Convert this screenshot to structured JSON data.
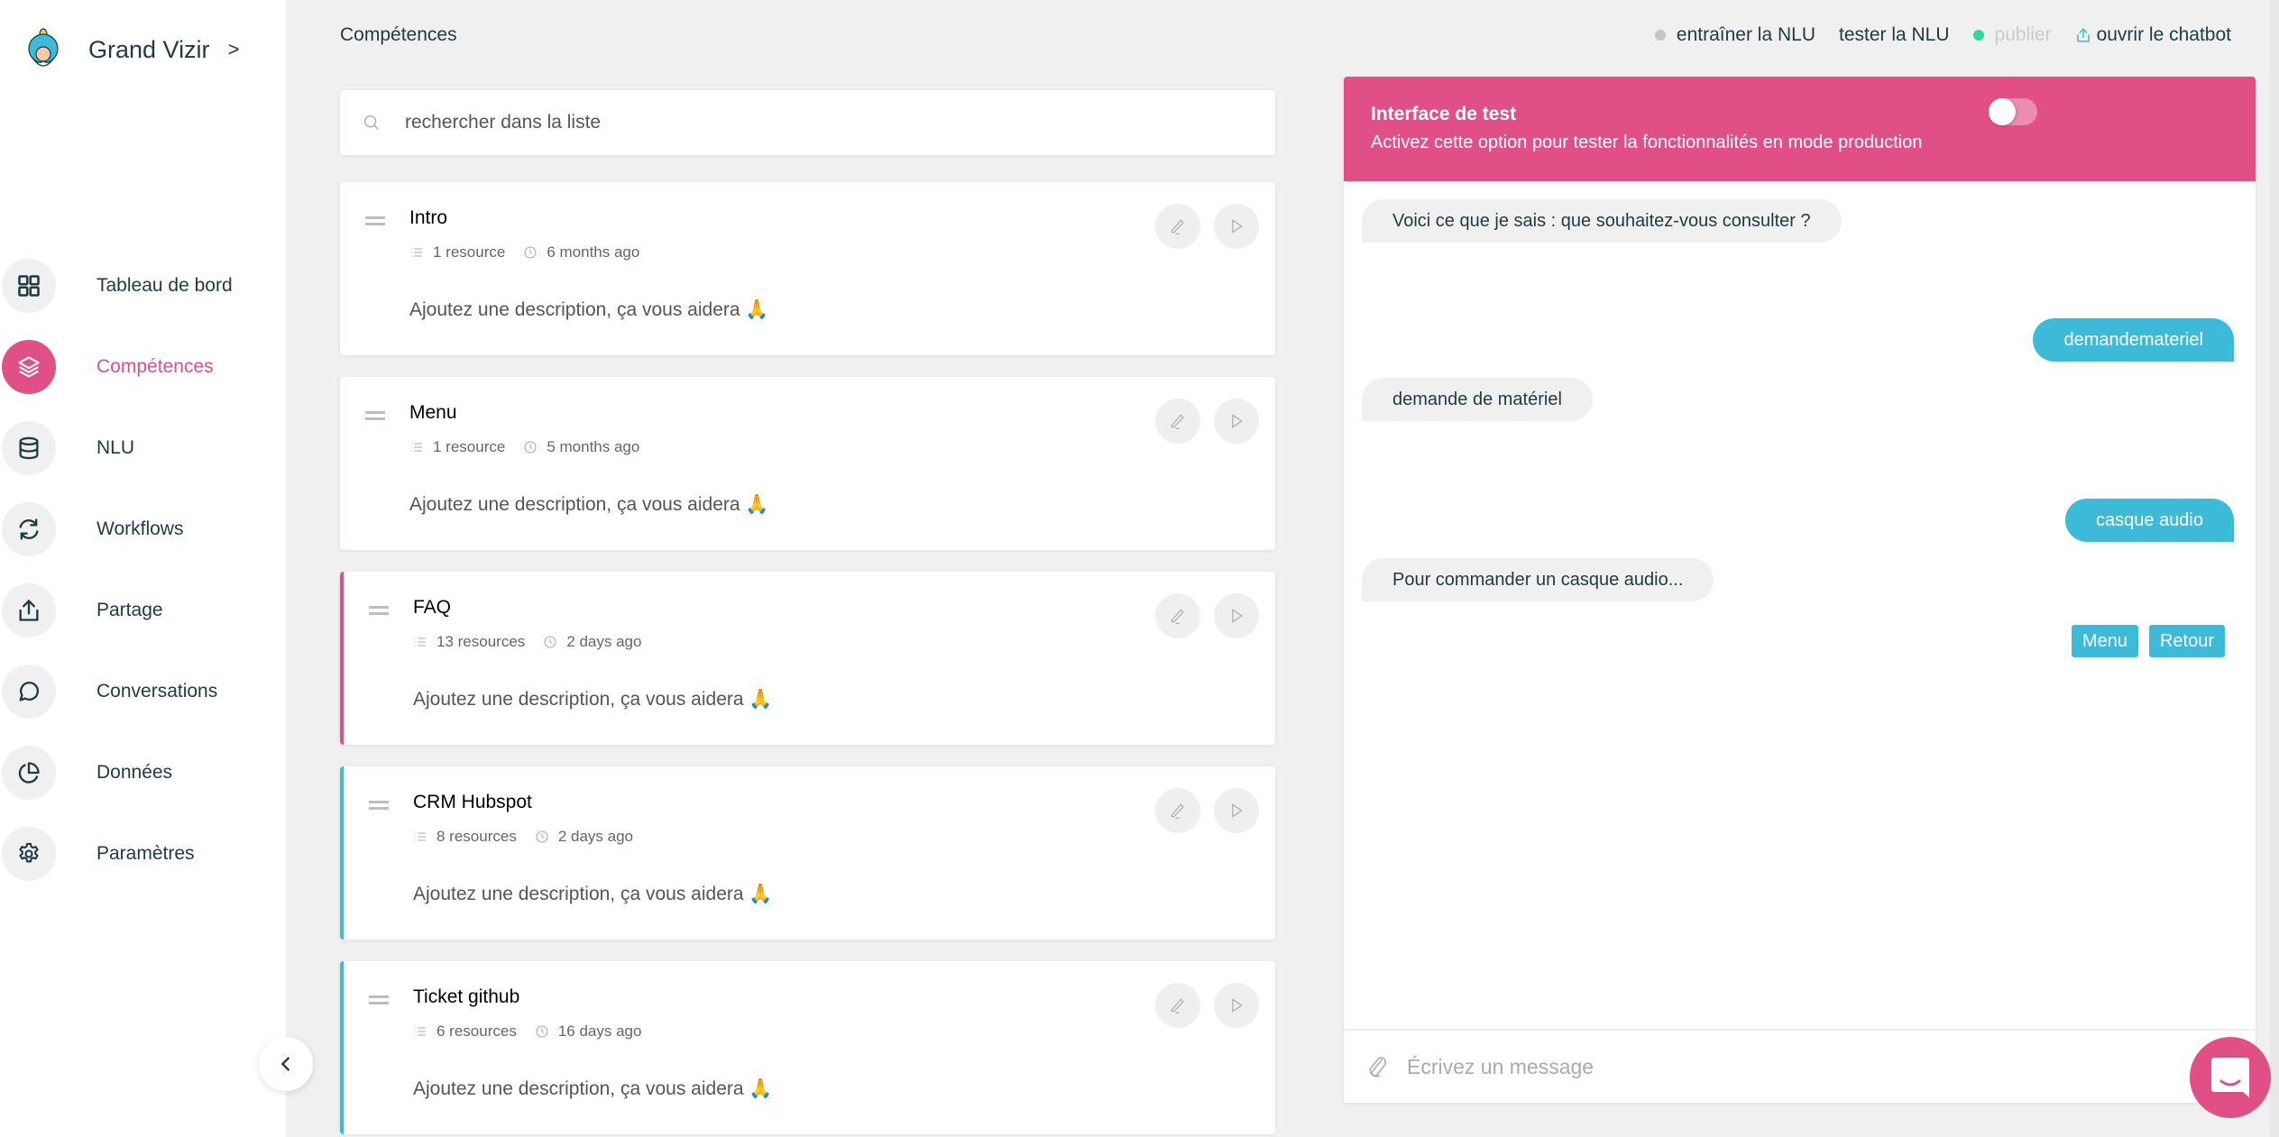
{
  "brand": {
    "name": "Grand Vizir",
    "chevron": ">",
    "logo_icon": "vizir-avatar-icon"
  },
  "sidebar": {
    "items": [
      {
        "label": "Tableau de bord",
        "icon": "grid-icon",
        "active": false
      },
      {
        "label": "Compétences",
        "icon": "layers-icon",
        "active": true
      },
      {
        "label": "NLU",
        "icon": "database-icon",
        "active": false
      },
      {
        "label": "Workflows",
        "icon": "refresh-icon",
        "active": false
      },
      {
        "label": "Partage",
        "icon": "share-upload-icon",
        "active": false
      },
      {
        "label": "Conversations",
        "icon": "chat-bubble-icon",
        "active": false
      },
      {
        "label": "Données",
        "icon": "pie-chart-icon",
        "active": false
      },
      {
        "label": "Paramètres",
        "icon": "gear-icon",
        "active": false
      }
    ],
    "collapse_icon": "chevron-left-icon"
  },
  "header": {
    "breadcrumb": "Compétences",
    "actions": {
      "train": "entraîner la NLU",
      "test": "tester la NLU",
      "publish": "publier",
      "open": "ouvrir le chatbot"
    },
    "colors": {
      "train_dot": "#c4c4c4",
      "publish_dot": "#2fd8a1",
      "open_icon": "#3dbad8"
    }
  },
  "search": {
    "placeholder": "rechercher dans la liste",
    "value": ""
  },
  "skills": [
    {
      "title": "Intro",
      "resources": "1 resource",
      "updated": "6 months ago",
      "description": "Ajoutez une description, ça vous aidera 🙏",
      "accent": "none"
    },
    {
      "title": "Menu",
      "resources": "1 resource",
      "updated": "5 months ago",
      "description": "Ajoutez une description, ça vous aidera 🙏",
      "accent": "none"
    },
    {
      "title": "FAQ",
      "resources": "13 resources",
      "updated": "2 days ago",
      "description": "Ajoutez une description, ça vous aidera 🙏",
      "accent": "pink"
    },
    {
      "title": "CRM Hubspot",
      "resources": "8 resources",
      "updated": "2 days ago",
      "description": "Ajoutez une description, ça vous aidera 🙏",
      "accent": "blue"
    },
    {
      "title": "Ticket github",
      "resources": "6 resources",
      "updated": "16 days ago",
      "description": "Ajoutez une description, ça vous aidera 🙏",
      "accent": "blue"
    }
  ],
  "test_panel": {
    "title": "Interface de test",
    "subtitle": "Activez cette option pour tester la fonctionnalités en mode production",
    "toggle_on": false,
    "messages": [
      {
        "from": "bot",
        "text": "Voici ce que je sais : que souhaitez-vous consulter ?"
      },
      {
        "from": "user",
        "text": "demandemateriel"
      },
      {
        "from": "bot",
        "text": "demande de matériel"
      },
      {
        "from": "user",
        "text": "casque audio"
      },
      {
        "from": "bot",
        "text": "Pour commander un casque audio..."
      }
    ],
    "quick_replies": [
      "Menu",
      "Retour"
    ],
    "composer_placeholder": "Écrivez un message"
  },
  "colors": {
    "accent_pink": "#e04f86",
    "accent_blue": "#3dbad8",
    "text_dark": "#1d3b44"
  }
}
